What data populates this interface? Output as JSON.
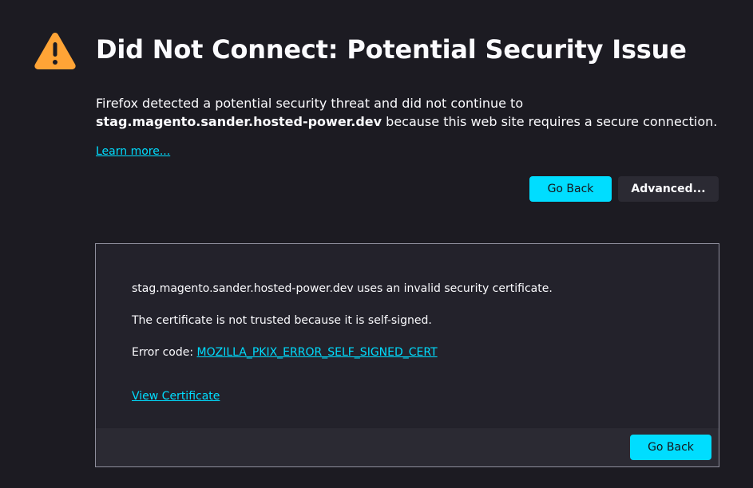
{
  "colors": {
    "background": "#1c1b22",
    "accent": "#00ddff",
    "warning": "#ffa436",
    "panel": "#23222b",
    "panel_footer": "#2b2a33"
  },
  "icons": {
    "warning": "warning-triangle-icon"
  },
  "header": {
    "title": "Did Not Connect: Potential Security Issue"
  },
  "intro": {
    "before_host": "Firefox detected a potential security threat and did not continue to ",
    "host": "stag.magento.sander.hosted-power.dev",
    "after_host": " because this web site requires a secure connection."
  },
  "links": {
    "learn_more": "Learn more..."
  },
  "buttons": {
    "go_back": "Go Back",
    "advanced": "Advanced..."
  },
  "advanced_panel": {
    "cert_message": "stag.magento.sander.hosted-power.dev uses an invalid security certificate.",
    "trust_message": "The certificate is not trusted because it is self-signed.",
    "error_code_label": "Error code: ",
    "error_code": "MOZILLA_PKIX_ERROR_SELF_SIGNED_CERT",
    "view_certificate": "View Certificate",
    "go_back": "Go Back"
  }
}
